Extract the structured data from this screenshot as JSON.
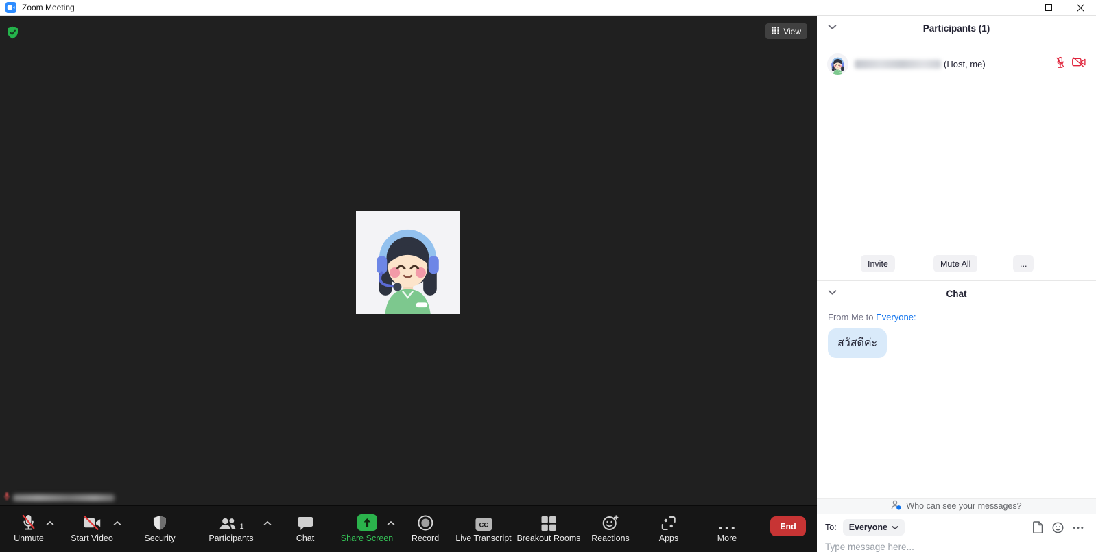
{
  "window": {
    "title": "Zoom Meeting"
  },
  "stage": {
    "view_button": "View",
    "avatar": "support-girl-cartoon",
    "nametag_redacted": true
  },
  "participants_panel": {
    "title": "Participants (1)",
    "participant": {
      "name_redacted": true,
      "role_suffix": "(Host, me)",
      "mic": "muted",
      "video": "off"
    },
    "actions": {
      "invite": "Invite",
      "mute_all": "Mute All",
      "more": "..."
    }
  },
  "chat_panel": {
    "title": "Chat",
    "from_prefix": "From Me to ",
    "from_target": "Everyone:",
    "messages": [
      {
        "text": "สวัสดีค่ะ"
      }
    ],
    "privacy_notice": "Who can see your messages?",
    "to_label": "To:",
    "to_value": "Everyone",
    "input_placeholder": "Type message here..."
  },
  "toolbar": {
    "unmute": {
      "label": "Unmute"
    },
    "start_video": {
      "label": "Start Video"
    },
    "security": {
      "label": "Security"
    },
    "participants": {
      "label": "Participants",
      "count": "1"
    },
    "chat": {
      "label": "Chat"
    },
    "share_screen": {
      "label": "Share Screen"
    },
    "record": {
      "label": "Record"
    },
    "live_transcript": {
      "label": "Live Transcript",
      "badge": "CC"
    },
    "breakout_rooms": {
      "label": "Breakout Rooms"
    },
    "reactions": {
      "label": "Reactions"
    },
    "apps": {
      "label": "Apps"
    },
    "more": {
      "label": "More"
    },
    "end": {
      "label": "End"
    }
  },
  "colors": {
    "accent_blue": "#0e72ed",
    "zoom_blue": "#2d8cff",
    "share_green": "#2bb24c",
    "danger_red": "#c73434",
    "muted_red": "#e0243c",
    "bubble_blue": "#d9eafa",
    "stage_bg": "#202020",
    "toolbar_bg": "#161616"
  }
}
